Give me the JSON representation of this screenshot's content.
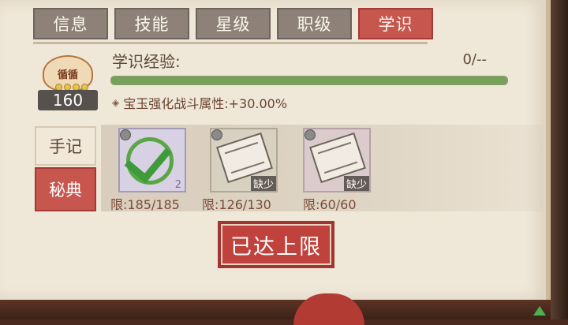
{
  "tabs": [
    {
      "label": "信息",
      "active": false
    },
    {
      "label": "技能",
      "active": false
    },
    {
      "label": "星级",
      "active": false
    },
    {
      "label": "职级",
      "active": false
    },
    {
      "label": "学识",
      "active": true
    }
  ],
  "badge": {
    "title": "循循",
    "level": "160"
  },
  "experience": {
    "label": "学识经验:",
    "value": "0/--",
    "progress": 1.0
  },
  "bonus": {
    "text": "宝玉强化战斗属性:+30.00%"
  },
  "side_buttons": {
    "notes": "手记",
    "secret": "秘典"
  },
  "items": [
    {
      "limit": "限:185/185",
      "tag": "",
      "quantity": "2",
      "icon": "checkmark-icon",
      "style": "purple"
    },
    {
      "limit": "限:126/130",
      "tag": "缺少",
      "quantity": "",
      "icon": "book-icon",
      "style": "grey"
    },
    {
      "limit": "限:60/60",
      "tag": "缺少",
      "quantity": "",
      "icon": "book-icon",
      "style": "pink"
    }
  ],
  "stamp": {
    "label": "已达上限"
  },
  "colors": {
    "accent": "#c7564e",
    "progress": "#76a15a",
    "panel": "#efe7d8"
  }
}
